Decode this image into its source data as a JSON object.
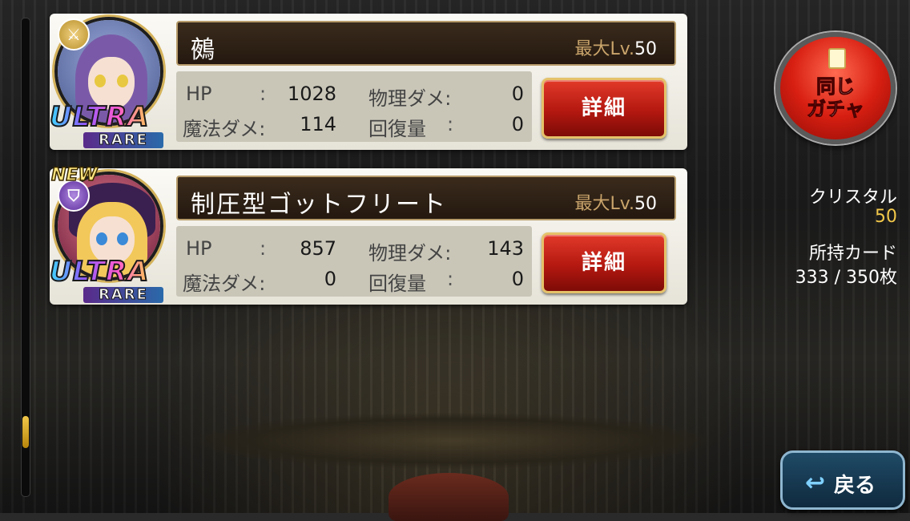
{
  "cards": [
    {
      "name": "鵺",
      "level_label": "最大Lv.",
      "level_value": "50",
      "badge_new": "",
      "rarity_top": "ULTRA",
      "rarity_bottom": "RARE",
      "stats": {
        "hp_label": "HP",
        "hp_value": "1028",
        "phys_label": "物理ダメ:",
        "phys_value": "0",
        "magic_label": "魔法ダメ:",
        "magic_value": "114",
        "heal_label": "回復量",
        "heal_value": "0",
        "colon": ":"
      },
      "detail_label": "詳細",
      "icon": "crossed-swords-icon",
      "hair_color": "#7a5aa8",
      "bg_color": "#6a7ab0"
    },
    {
      "name": "制圧型ゴットフリート",
      "level_label": "最大Lv.",
      "level_value": "50",
      "badge_new": "NEW",
      "rarity_top": "ULTRA",
      "rarity_bottom": "RARE",
      "stats": {
        "hp_label": "HP",
        "hp_value": "857",
        "phys_label": "物理ダメ:",
        "phys_value": "143",
        "magic_label": "魔法ダメ:",
        "magic_value": "0",
        "heal_label": "回復量",
        "heal_value": "0",
        "colon": ":"
      },
      "detail_label": "詳細",
      "icon": "shield-icon",
      "hair_color": "#f2c85a",
      "bg_color": "#c04a5a"
    }
  ],
  "side": {
    "gacha_label": "同じ\nガチャ",
    "crystal_label": "クリスタル",
    "crystal_value": "50",
    "cards_label": "所持カード",
    "cards_value": "333 / 350枚"
  },
  "back_label": "戻る",
  "colors": {
    "accent_gold": "#f2c84a",
    "detail_red": "#b41810",
    "back_blue": "#1f4a66"
  }
}
